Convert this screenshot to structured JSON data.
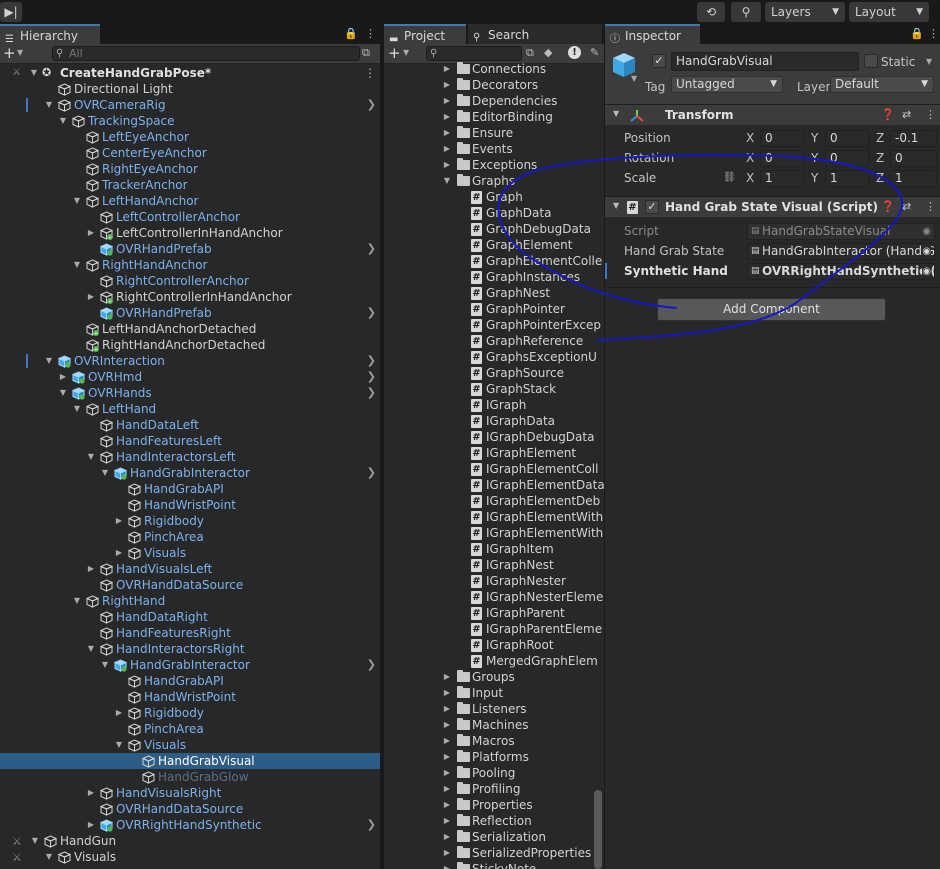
{
  "toolbar": {
    "layers_label": "Layers",
    "layout_label": "Layout",
    "history_icon": "history-icon",
    "search_icon": "search-icon"
  },
  "hierarchy": {
    "tab_label": "Hierarchy",
    "search_placeholder": "All",
    "scene_name": "CreateHandGrabPose*",
    "rows": [
      {
        "label": "Directional Light",
        "depth": 1,
        "caret": "",
        "style": "plain"
      },
      {
        "label": "OVRCameraRig",
        "depth": 1,
        "caret": "open",
        "style": "blue",
        "arrow": true,
        "mark": true
      },
      {
        "label": "TrackingSpace",
        "depth": 2,
        "caret": "open",
        "style": "blue"
      },
      {
        "label": "LeftEyeAnchor",
        "depth": 3,
        "caret": "",
        "style": "blue"
      },
      {
        "label": "CenterEyeAnchor",
        "depth": 3,
        "caret": "",
        "style": "blue"
      },
      {
        "label": "RightEyeAnchor",
        "depth": 3,
        "caret": "",
        "style": "blue"
      },
      {
        "label": "TrackerAnchor",
        "depth": 3,
        "caret": "",
        "style": "blue"
      },
      {
        "label": "LeftHandAnchor",
        "depth": 3,
        "caret": "open",
        "style": "blue"
      },
      {
        "label": "LeftControllerAnchor",
        "depth": 4,
        "caret": "",
        "style": "blue"
      },
      {
        "label": "LeftControllerInHandAnchor",
        "depth": 4,
        "caret": "closed",
        "style": "plain",
        "added": true
      },
      {
        "label": "OVRHandPrefab",
        "depth": 4,
        "caret": "",
        "style": "blue",
        "arrow": true,
        "prefab": true
      },
      {
        "label": "RightHandAnchor",
        "depth": 3,
        "caret": "open",
        "style": "blue"
      },
      {
        "label": "RightControllerAnchor",
        "depth": 4,
        "caret": "",
        "style": "blue"
      },
      {
        "label": "RightControllerInHandAnchor",
        "depth": 4,
        "caret": "closed",
        "style": "plain",
        "added": true
      },
      {
        "label": "OVRHandPrefab",
        "depth": 4,
        "caret": "",
        "style": "blue",
        "arrow": true,
        "prefab": true
      },
      {
        "label": "LeftHandAnchorDetached",
        "depth": 3,
        "caret": "",
        "style": "plain",
        "added": true
      },
      {
        "label": "RightHandAnchorDetached",
        "depth": 3,
        "caret": "",
        "style": "plain",
        "added": true
      },
      {
        "label": "OVRInteraction",
        "depth": 1,
        "caret": "open",
        "style": "blue",
        "arrow": true,
        "mark": true,
        "prefab": true
      },
      {
        "label": "OVRHmd",
        "depth": 2,
        "caret": "closed",
        "style": "blue",
        "arrow": true,
        "prefab": true
      },
      {
        "label": "OVRHands",
        "depth": 2,
        "caret": "open",
        "style": "blue",
        "arrow": true,
        "prefab": true
      },
      {
        "label": "LeftHand",
        "depth": 3,
        "caret": "open",
        "style": "blue"
      },
      {
        "label": "HandDataLeft",
        "depth": 4,
        "caret": "",
        "style": "blue"
      },
      {
        "label": "HandFeaturesLeft",
        "depth": 4,
        "caret": "",
        "style": "blue"
      },
      {
        "label": "HandInteractorsLeft",
        "depth": 4,
        "caret": "open",
        "style": "blue"
      },
      {
        "label": "HandGrabInteractor",
        "depth": 5,
        "caret": "open",
        "style": "blue",
        "arrow": true,
        "prefab": true
      },
      {
        "label": "HandGrabAPI",
        "depth": 6,
        "caret": "",
        "style": "blue"
      },
      {
        "label": "HandWristPoint",
        "depth": 6,
        "caret": "",
        "style": "blue"
      },
      {
        "label": "Rigidbody",
        "depth": 6,
        "caret": "closed",
        "style": "blue"
      },
      {
        "label": "PinchArea",
        "depth": 6,
        "caret": "",
        "style": "blue"
      },
      {
        "label": "Visuals",
        "depth": 6,
        "caret": "closed",
        "style": "blue"
      },
      {
        "label": "HandVisualsLeft",
        "depth": 4,
        "caret": "closed",
        "style": "blue"
      },
      {
        "label": "OVRHandDataSource",
        "depth": 4,
        "caret": "",
        "style": "blue"
      },
      {
        "label": "RightHand",
        "depth": 3,
        "caret": "open",
        "style": "blue"
      },
      {
        "label": "HandDataRight",
        "depth": 4,
        "caret": "",
        "style": "blue"
      },
      {
        "label": "HandFeaturesRight",
        "depth": 4,
        "caret": "",
        "style": "blue"
      },
      {
        "label": "HandInteractorsRight",
        "depth": 4,
        "caret": "open",
        "style": "blue"
      },
      {
        "label": "HandGrabInteractor",
        "depth": 5,
        "caret": "open",
        "style": "blue",
        "arrow": true,
        "prefab": true
      },
      {
        "label": "HandGrabAPI",
        "depth": 6,
        "caret": "",
        "style": "blue"
      },
      {
        "label": "HandWristPoint",
        "depth": 6,
        "caret": "",
        "style": "blue"
      },
      {
        "label": "Rigidbody",
        "depth": 6,
        "caret": "closed",
        "style": "blue"
      },
      {
        "label": "PinchArea",
        "depth": 6,
        "caret": "",
        "style": "blue"
      },
      {
        "label": "Visuals",
        "depth": 6,
        "caret": "open",
        "style": "blue"
      },
      {
        "label": "HandGrabVisual",
        "depth": 7,
        "caret": "",
        "style": "selected"
      },
      {
        "label": "HandGrabGlow",
        "depth": 7,
        "caret": "",
        "style": "dim"
      },
      {
        "label": "HandVisualsRight",
        "depth": 4,
        "caret": "closed",
        "style": "blue"
      },
      {
        "label": "OVRHandDataSource",
        "depth": 4,
        "caret": "",
        "style": "blue"
      },
      {
        "label": "OVRRightHandSynthetic",
        "depth": 4,
        "caret": "closed",
        "style": "blue",
        "arrow": true,
        "prefab": true
      },
      {
        "label": "HandGun",
        "depth": 0,
        "caret": "open",
        "style": "plain"
      },
      {
        "label": "Visuals",
        "depth": 1,
        "caret": "open",
        "style": "plain"
      }
    ]
  },
  "project": {
    "tab_label": "Project",
    "search_tab_label": "Search",
    "items": [
      {
        "label": "Connections",
        "type": "folder",
        "caret": "closed"
      },
      {
        "label": "Decorators",
        "type": "folder",
        "caret": "closed"
      },
      {
        "label": "Dependencies",
        "type": "folder",
        "caret": "closed"
      },
      {
        "label": "EditorBinding",
        "type": "folder",
        "caret": "closed"
      },
      {
        "label": "Ensure",
        "type": "folder",
        "caret": "closed"
      },
      {
        "label": "Events",
        "type": "folder",
        "caret": "closed"
      },
      {
        "label": "Exceptions",
        "type": "folder",
        "caret": "closed"
      },
      {
        "label": "Graphs",
        "type": "folder",
        "caret": "open"
      },
      {
        "label": "Graph",
        "type": "script"
      },
      {
        "label": "GraphData",
        "type": "script"
      },
      {
        "label": "GraphDebugData",
        "type": "script"
      },
      {
        "label": "GraphElement",
        "type": "script"
      },
      {
        "label": "GraphElementColle",
        "type": "script"
      },
      {
        "label": "GraphInstances",
        "type": "script"
      },
      {
        "label": "GraphNest",
        "type": "script"
      },
      {
        "label": "GraphPointer",
        "type": "script"
      },
      {
        "label": "GraphPointerExcep",
        "type": "script"
      },
      {
        "label": "GraphReference",
        "type": "script"
      },
      {
        "label": "GraphsExceptionU",
        "type": "script"
      },
      {
        "label": "GraphSource",
        "type": "script"
      },
      {
        "label": "GraphStack",
        "type": "script"
      },
      {
        "label": "IGraph",
        "type": "script"
      },
      {
        "label": "IGraphData",
        "type": "script"
      },
      {
        "label": "IGraphDebugData",
        "type": "script"
      },
      {
        "label": "IGraphElement",
        "type": "script"
      },
      {
        "label": "IGraphElementColl",
        "type": "script"
      },
      {
        "label": "IGraphElementData",
        "type": "script"
      },
      {
        "label": "IGraphElementDeb",
        "type": "script"
      },
      {
        "label": "IGraphElementWith",
        "type": "script"
      },
      {
        "label": "IGraphElementWith",
        "type": "script"
      },
      {
        "label": "IGraphItem",
        "type": "script"
      },
      {
        "label": "IGraphNest",
        "type": "script"
      },
      {
        "label": "IGraphNester",
        "type": "script"
      },
      {
        "label": "IGraphNesterEleme",
        "type": "script"
      },
      {
        "label": "IGraphParent",
        "type": "script"
      },
      {
        "label": "IGraphParentEleme",
        "type": "script"
      },
      {
        "label": "IGraphRoot",
        "type": "script"
      },
      {
        "label": "MergedGraphElem",
        "type": "script"
      },
      {
        "label": "Groups",
        "type": "folder",
        "caret": "closed"
      },
      {
        "label": "Input",
        "type": "folder",
        "caret": "closed"
      },
      {
        "label": "Listeners",
        "type": "folder",
        "caret": "closed"
      },
      {
        "label": "Machines",
        "type": "folder",
        "caret": "closed"
      },
      {
        "label": "Macros",
        "type": "folder",
        "caret": "closed"
      },
      {
        "label": "Platforms",
        "type": "folder",
        "caret": "closed"
      },
      {
        "label": "Pooling",
        "type": "folder",
        "caret": "closed"
      },
      {
        "label": "Profiling",
        "type": "folder",
        "caret": "closed"
      },
      {
        "label": "Properties",
        "type": "folder",
        "caret": "closed"
      },
      {
        "label": "Reflection",
        "type": "folder",
        "caret": "closed"
      },
      {
        "label": "Serialization",
        "type": "folder",
        "caret": "closed"
      },
      {
        "label": "SerializedProperties",
        "type": "folder",
        "caret": "closed"
      },
      {
        "label": "StickyNote",
        "type": "folder",
        "caret": "closed"
      }
    ]
  },
  "inspector": {
    "tab_label": "Inspector",
    "object_name": "HandGrabVisual",
    "static_label": "Static",
    "tag_label": "Tag",
    "tag_value": "Untagged",
    "layer_label": "Layer",
    "layer_value": "Default",
    "transform": {
      "title": "Transform",
      "position_label": "Position",
      "rotation_label": "Rotation",
      "scale_label": "Scale",
      "position": {
        "x": "0",
        "y": "0",
        "z": "-0.1"
      },
      "rotation": {
        "x": "0",
        "y": "0",
        "z": "0"
      },
      "scale": {
        "x": "1",
        "y": "1",
        "z": "1"
      }
    },
    "script_component": {
      "title": "Hand Grab State Visual (Script)",
      "script_label": "Script",
      "script_value": "HandGrabStateVisual",
      "state_label": "Hand Grab State",
      "state_value": "HandGrabInteractor (Hand G",
      "synthetic_label": "Synthetic Hand",
      "synthetic_value": "OVRRightHandSynthetic (S"
    },
    "add_component_label": "Add Component",
    "axis_x": "X",
    "axis_y": "Y",
    "axis_z": "Z"
  },
  "colors": {
    "accent": "#3a79bb",
    "selection": "#2c5d87",
    "annotation_stroke": "#1717c9",
    "blue_text": "#7bb1f2"
  }
}
